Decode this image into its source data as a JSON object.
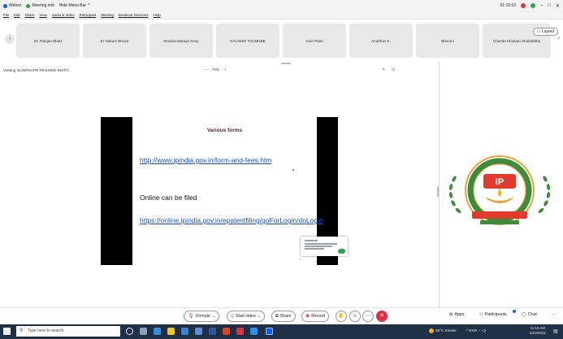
{
  "titlebar": {
    "app_name": "Webex",
    "meeting_info": "Meeting info",
    "hide_menu_bar": "Hide Menu Bar",
    "time": "01:15:53",
    "minimize": "–",
    "maximize": "□",
    "close": "✕"
  },
  "menubar": {
    "items": [
      "File",
      "Edit",
      "Share",
      "View",
      "Audio & Video",
      "Participant",
      "Meeting",
      "Breakout Sessions",
      "Help"
    ]
  },
  "participants": {
    "prev_arrow": "‹",
    "next_arrow": "›",
    "tiles": [
      "Dr. Ranjan Bhatt",
      "Er Nakum Bhava",
      "Martina Maniya Sony",
      "KAUSHIK TAUMNBB",
      "Amit Patel",
      "Anubhav K.",
      "Bhoomi",
      "Chanda Hiralyan Shailabbha"
    ],
    "layout_label": "Layout"
  },
  "stage": {
    "viewing_text": "Viewing IILOMTM IPR TRAINING INSTIT...",
    "zoom_minus": "−",
    "zoom_value": "74%",
    "zoom_plus": "+"
  },
  "slide": {
    "title": "Various forms",
    "link1": "http://www.ipindia.gov.in/form-and-fees.htm",
    "text": "Online can be filed",
    "link2": "https://online.ipindia.gov.in/epatentfiling/goForLogin/doLogin"
  },
  "toolbar": {
    "unmute": "Unmute",
    "start_video": "Start video",
    "share": "Share",
    "record": "Record",
    "apps": "Apps",
    "participants": "Participants",
    "chat": "Chat",
    "more": "···"
  },
  "taskbar": {
    "search_placeholder": "Type here to search",
    "weather": "35°C Smoke",
    "tray_text": "^ ENG",
    "time": "11:15 AM",
    "date": "5/10/2023"
  },
  "colors": {
    "leave_red": "#e02f44",
    "accent_blue": "#0b5cff",
    "slide_title": "#6b1238",
    "link_blue": "#1a4fcf",
    "taskbar_bg": "#1f2f45"
  }
}
